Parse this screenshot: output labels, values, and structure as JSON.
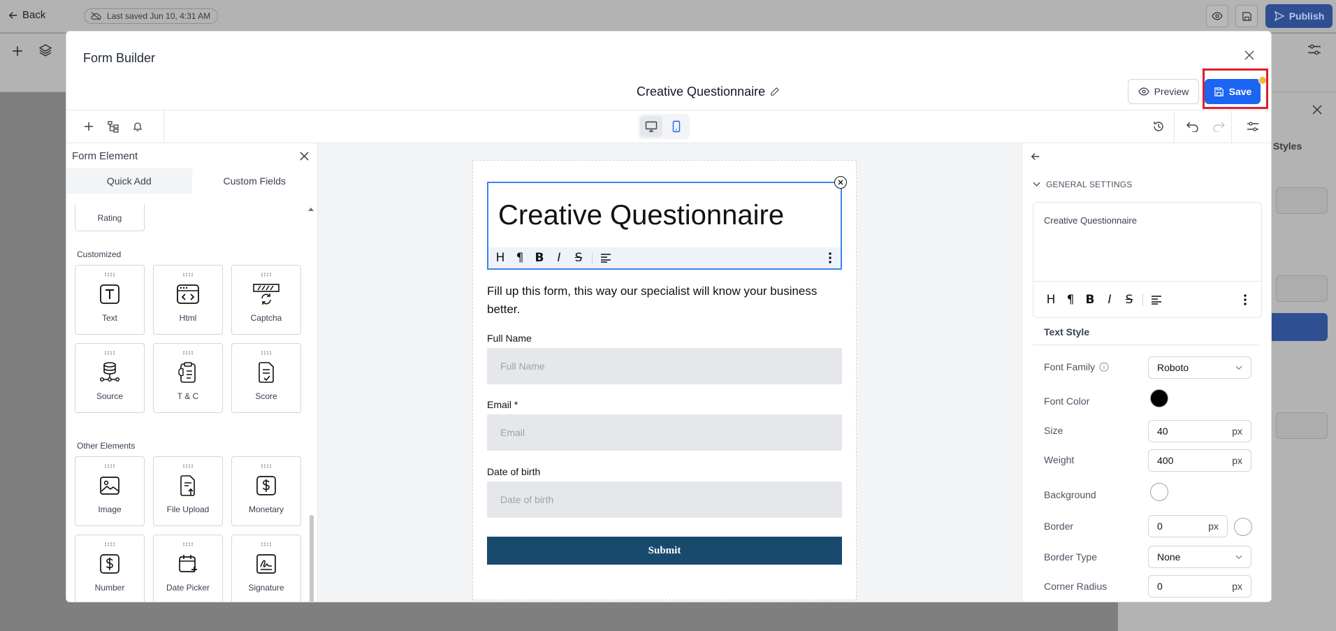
{
  "app": {
    "back_label": "Back",
    "last_saved": "Last saved Jun 10, 4:31 AM",
    "publish_label": "Publish",
    "styles_label": "Styles"
  },
  "modal": {
    "title": "Form Builder",
    "form_name": "Creative Questionnaire",
    "preview_label": "Preview",
    "save_label": "Save",
    "accent_color": "#1c64f2",
    "highlight_color": "#e11d2a"
  },
  "left_panel": {
    "title": "Form Element",
    "tabs": [
      "Quick Add",
      "Custom Fields"
    ],
    "active_tab": "Custom Fields",
    "rating_label": "Rating",
    "sections": [
      {
        "label": "Customized",
        "items": [
          {
            "label": "Text",
            "icon": "text-icon"
          },
          {
            "label": "Html",
            "icon": "html-icon"
          },
          {
            "label": "Captcha",
            "icon": "captcha-icon"
          },
          {
            "label": "Source",
            "icon": "source-icon"
          },
          {
            "label": "T & C",
            "icon": "terms-icon"
          },
          {
            "label": "Score",
            "icon": "score-icon"
          }
        ]
      },
      {
        "label": "Other Elements",
        "items": [
          {
            "label": "Image",
            "icon": "image-icon"
          },
          {
            "label": "File Upload",
            "icon": "file-upload-icon"
          },
          {
            "label": "Monetary",
            "icon": "monetary-icon"
          },
          {
            "label": "Number",
            "icon": "number-icon"
          },
          {
            "label": "Date Picker",
            "icon": "date-picker-icon"
          },
          {
            "label": "Signature",
            "icon": "signature-icon"
          }
        ]
      }
    ]
  },
  "form": {
    "heading": "Creative Questionnaire",
    "intro": "Fill up this form, this way our specialist will know your business better.",
    "fields": [
      {
        "label": "Full Name",
        "placeholder": "Full Name"
      },
      {
        "label": "Email *",
        "placeholder": "Email"
      },
      {
        "label": "Date of birth",
        "placeholder": "Date of birth"
      }
    ],
    "submit_label": "Submit",
    "submit_color": "#184a6e"
  },
  "settings": {
    "section_title": "GENERAL SETTINGS",
    "editor_text": "Creative Questionnaire",
    "text_style_label": "Text Style",
    "font_family_label": "Font Family",
    "font_family_value": "Roboto",
    "font_color_label": "Font Color",
    "font_color_value": "#000000",
    "size_label": "Size",
    "size_value": "40",
    "weight_label": "Weight",
    "weight_value": "400",
    "background_label": "Background",
    "border_label": "Border",
    "border_value": "0",
    "border_type_label": "Border Type",
    "border_type_value": "None",
    "corner_radius_label": "Corner Radius",
    "corner_radius_value": "0",
    "unit": "px"
  }
}
